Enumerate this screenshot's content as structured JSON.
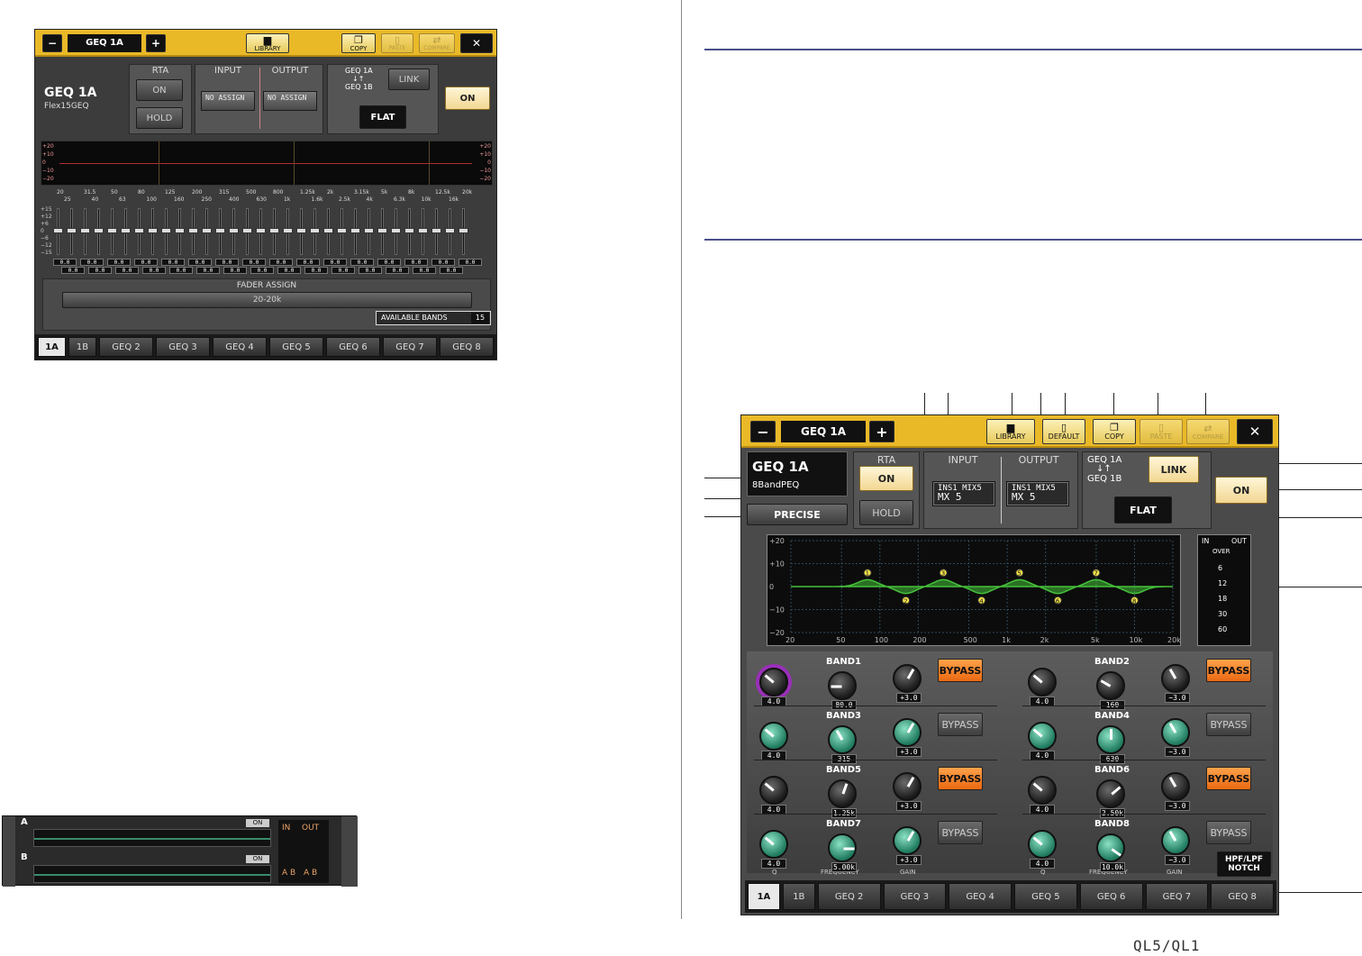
{
  "left_window": {
    "title": "GEQ 1A",
    "buttons": {
      "minus": "−",
      "plus": "+",
      "library": "LIBRARY",
      "copy": "COPY",
      "paste": "PASTE",
      "compare": "COMPARE",
      "close": "✕"
    },
    "geq_name": "GEQ 1A",
    "geq_type": "Flex15GEQ",
    "rta": {
      "label": "RTA",
      "on": "ON",
      "hold": "HOLD"
    },
    "input": {
      "label": "INPUT",
      "value": "NO ASSIGN"
    },
    "output": {
      "label": "OUTPUT",
      "value": "NO ASSIGN"
    },
    "link_group": {
      "line1": "GEQ 1A",
      "arrows": "↓↑",
      "line2": "GEQ 1B",
      "link": "LINK",
      "flat": "FLAT"
    },
    "on_button": "ON",
    "graph_scale_left": [
      "+20",
      "+10",
      "0",
      "−10",
      "−20"
    ],
    "graph_scale_right": [
      "+20",
      "+10",
      "0",
      "−10",
      "−20"
    ],
    "freq_row1": [
      "20",
      "31.5",
      "50",
      "80",
      "125",
      "200",
      "315",
      "500",
      "800",
      "1.25k",
      "2k",
      "3.15k",
      "5k",
      "8k",
      "12.5k",
      "20k"
    ],
    "freq_row2": [
      "25",
      "40",
      "63",
      "100",
      "160",
      "250",
      "400",
      "630",
      "1k",
      "1.6k",
      "2.5k",
      "4k",
      "6.3k",
      "10k",
      "16k"
    ],
    "fader_scale": [
      "+15",
      "+12",
      "+6",
      "0",
      "−6",
      "−12",
      "−15"
    ],
    "fader_values": [
      "0.0",
      "0.0",
      "0.0",
      "0.0",
      "0.0",
      "0.0",
      "0.0",
      "0.0",
      "0.0",
      "0.0",
      "0.0",
      "0.0",
      "0.0",
      "0.0",
      "0.0",
      "0.0",
      "0.0",
      "0.0",
      "0.0",
      "0.0",
      "0.0",
      "0.0",
      "0.0",
      "0.0",
      "0.0",
      "0.0",
      "0.0",
      "0.0",
      "0.0",
      "0.0",
      "0.0"
    ],
    "fader_assign": {
      "label": "FADER ASSIGN",
      "value": "20-20k"
    },
    "available_bands": {
      "label": "AVAILABLE BANDS",
      "value": "15"
    },
    "tabs": [
      "1A",
      "1B",
      "GEQ 2",
      "GEQ 3",
      "GEQ 4",
      "GEQ 5",
      "GEQ 6",
      "GEQ 7",
      "GEQ 8"
    ]
  },
  "meter_strip": {
    "rows": [
      {
        "label": "A",
        "on": "ON"
      },
      {
        "label": "B",
        "on": "ON"
      }
    ],
    "in": "IN",
    "out": "OUT",
    "ab1": "A B",
    "ab2": "A B"
  },
  "right_window": {
    "title": "GEQ 1A",
    "buttons": {
      "minus": "−",
      "plus": "+",
      "library": "LIBRARY",
      "default": "DEFAULT",
      "copy": "COPY",
      "paste": "PASTE",
      "compare": "COMPARE",
      "close": "✕"
    },
    "geq_name": "GEQ 1A",
    "geq_type": "8BandPEQ",
    "precise": "PRECISE",
    "rta": {
      "label": "RTA",
      "on": "ON",
      "hold": "HOLD"
    },
    "input": {
      "label": "INPUT",
      "line1": "INS1 MIX5",
      "line2": "MX 5"
    },
    "output": {
      "label": "OUTPUT",
      "line1": "INS1 MIX5",
      "line2": "MX 5"
    },
    "link_group": {
      "line1": "GEQ 1A",
      "arrows": "↓↑",
      "line2": "GEQ 1B",
      "link": "LINK",
      "flat": "FLAT"
    },
    "on_button": "ON",
    "graph_y": [
      "+20",
      "+10",
      "0",
      "−10",
      "−20"
    ],
    "graph_x": [
      "20",
      "50",
      "100",
      "200",
      "500",
      "1k",
      "2k",
      "5k",
      "10k",
      "20k"
    ],
    "meter": {
      "in": "IN",
      "out": "OUT",
      "over": "OVER",
      "scale": [
        "6",
        "12",
        "18",
        "30",
        "60"
      ]
    },
    "bands": [
      {
        "name": "BAND1",
        "q": "4.0",
        "freq": "80.0",
        "gain": "+3.0",
        "bypass": "BYPASS",
        "bypass_on": true
      },
      {
        "name": "BAND2",
        "q": "4.0",
        "freq": "160",
        "gain": "−3.0",
        "bypass": "BYPASS",
        "bypass_on": true
      },
      {
        "name": "BAND3",
        "q": "4.0",
        "freq": "315",
        "gain": "+3.0",
        "bypass": "BYPASS",
        "bypass_on": false
      },
      {
        "name": "BAND4",
        "q": "4.0",
        "freq": "630",
        "gain": "−3.0",
        "bypass": "BYPASS",
        "bypass_on": false
      },
      {
        "name": "BAND5",
        "q": "4.0",
        "freq": "1.25k",
        "gain": "+3.0",
        "bypass": "BYPASS",
        "bypass_on": true
      },
      {
        "name": "BAND6",
        "q": "4.0",
        "freq": "2.50k",
        "gain": "−3.0",
        "bypass": "BYPASS",
        "bypass_on": true
      },
      {
        "name": "BAND7",
        "q": "4.0",
        "freq": "5.00k",
        "gain": "+3.0",
        "bypass": "BYPASS",
        "bypass_on": false
      },
      {
        "name": "BAND8",
        "q": "4.0",
        "freq": "10.0k",
        "gain": "−3.0",
        "bypass": "BYPASS",
        "bypass_on": false
      }
    ],
    "knob_labels": {
      "q": "Q",
      "freq": "FREQUENCY",
      "gain": "GAIN"
    },
    "hpf_lpf": {
      "line1": "HPF/LPF",
      "line2": "NOTCH"
    },
    "tabs": [
      "1A",
      "1B",
      "GEQ 2",
      "GEQ 3",
      "GEQ 4",
      "GEQ 5",
      "GEQ 6",
      "GEQ 7",
      "GEQ 8"
    ]
  },
  "brand": "QL5/QL1",
  "colors": {
    "yellow": "#e9b928",
    "bypass_on": "#f07a1e",
    "curve": "#45c23a",
    "teal": "#3fb58f"
  }
}
